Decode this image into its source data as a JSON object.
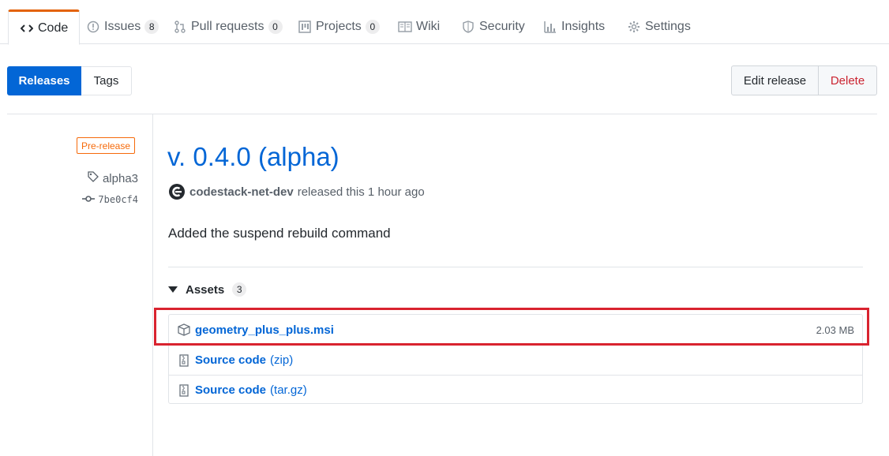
{
  "tabs": [
    {
      "label": "Code",
      "icon": "code-icon",
      "count": null,
      "selected": true
    },
    {
      "label": "Issues",
      "icon": "issue-icon",
      "count": "8"
    },
    {
      "label": "Pull requests",
      "icon": "pull-request-icon",
      "count": "0"
    },
    {
      "label": "Projects",
      "icon": "project-icon",
      "count": "0"
    },
    {
      "label": "Wiki",
      "icon": "book-icon",
      "count": null
    },
    {
      "label": "Security",
      "icon": "shield-icon",
      "count": null
    },
    {
      "label": "Insights",
      "icon": "graph-icon",
      "count": null
    },
    {
      "label": "Settings",
      "icon": "gear-icon",
      "count": null
    }
  ],
  "subnav": {
    "releases": "Releases",
    "tags": "Tags"
  },
  "actions": {
    "edit": "Edit release",
    "delete": "Delete"
  },
  "release": {
    "label": "Pre-release",
    "tag": "alpha3",
    "commit": "7be0cf4",
    "title": "v. 0.4.0 (alpha)",
    "author": "codestack-net-dev",
    "released": "released this 1 hour ago",
    "description": "Added the suspend rebuild command"
  },
  "assets": {
    "label": "Assets",
    "count": "3",
    "items": [
      {
        "name": "geometry_plus_plus.msi",
        "ext": "",
        "size": "2.03 MB",
        "icon": "package-icon"
      },
      {
        "name": "Source code",
        "ext": "(zip)",
        "size": "",
        "icon": "file-zip-icon"
      },
      {
        "name": "Source code",
        "ext": "(tar.gz)",
        "size": "",
        "icon": "file-zip-icon"
      }
    ]
  },
  "colors": {
    "accent": "#0366d6",
    "tab_underline": "#e36209",
    "prerelease": "#f66a0a",
    "delete": "#cb2431",
    "highlight": "#d9232f"
  }
}
